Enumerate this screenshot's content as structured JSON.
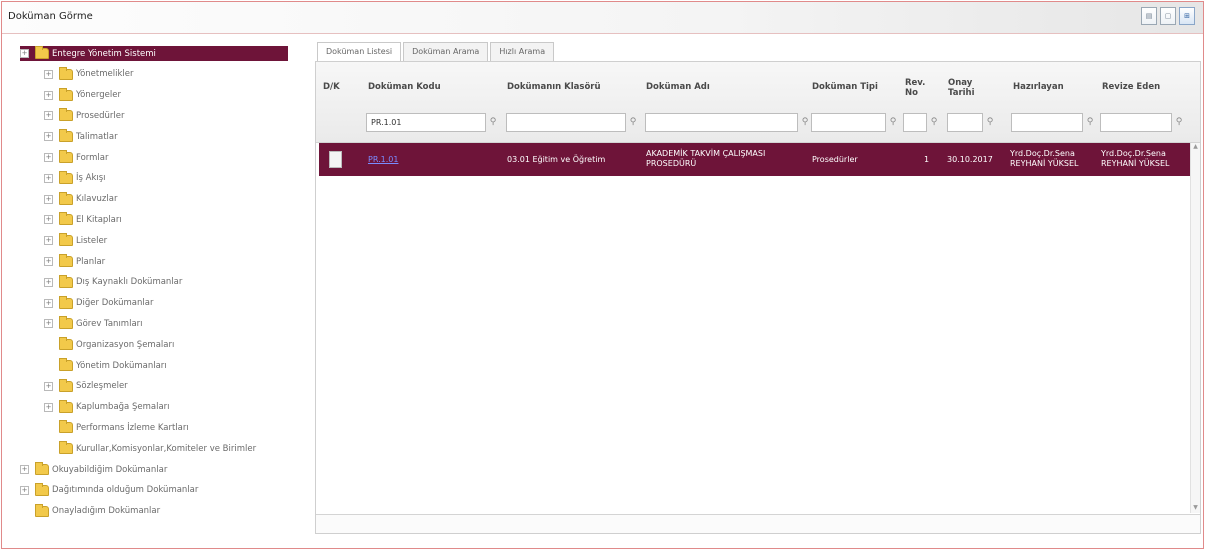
{
  "window": {
    "title": "Doküman Görme"
  },
  "toolbar_icons": [
    "document-icon",
    "page-icon",
    "network-icon"
  ],
  "tree": {
    "root": "Entegre Yönetim Sistemi",
    "children": [
      "Yönetmelikler",
      "Yönergeler",
      "Prosedürler",
      "Talimatlar",
      "Formlar",
      "İş Akışı",
      "Kılavuzlar",
      "El Kitapları",
      "Listeler",
      "Planlar",
      "Dış Kaynaklı Dokümanlar",
      "Diğer Dokümanlar",
      "Görev Tanımları",
      "Organizasyon Şemaları",
      "Yönetim Dokümanları",
      "Sözleşmeler",
      "Kaplumbağa Şemaları",
      "Performans İzleme Kartları",
      "Kurullar,Komisyonlar,Komiteler ve Birimler"
    ],
    "top_level": [
      "Okuyabildiğim Dokümanlar",
      "Dağıtımında olduğum Dokümanlar",
      "Onayladığım Dokümanlar"
    ]
  },
  "tabs": [
    "Doküman Listesi",
    "Doküman Arama",
    "Hızlı Arama"
  ],
  "grid": {
    "columns": [
      "D/K",
      "Doküman Kodu",
      "Dokümanın Klasörü",
      "Doküman Adı",
      "Doküman Tipi",
      "Rev. No",
      "Onay Tarihi",
      "Hazırlayan",
      "Revize Eden"
    ],
    "filter_code": "PR.1.01",
    "rows": [
      {
        "code": "PR.1.01",
        "folder": "03.01 Eğitim ve Öğretim",
        "name": "AKADEMİK TAKVİM ÇALIŞMASI PROSEDÜRÜ",
        "type": "Prosedürler",
        "rev": "1",
        "date": "30.10.2017",
        "prepared": "Yrd.Doç.Dr.Sena REYHANİ YÜKSEL",
        "revised": "Yrd.Doç.Dr.Sena REYHANİ YÜKSEL"
      }
    ]
  },
  "colors": {
    "selected": "#6e1439",
    "folder": "#f2c94a"
  }
}
